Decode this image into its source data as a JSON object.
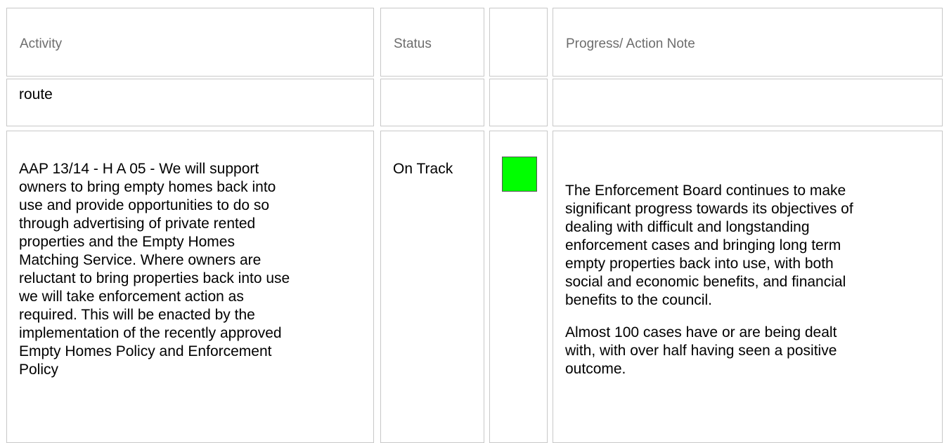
{
  "table": {
    "headers": {
      "activity": "Activity",
      "status": "Status",
      "indicator": "",
      "note": "Progress/ Action Note"
    },
    "rows": [
      {
        "activity": "route",
        "status": "",
        "note": ""
      },
      {
        "activity": "AAP 13/14 - H A 05 - We will support\nowners to bring empty homes back into\nuse and provide opportunities to do so\nthrough advertising of private rented\nproperties and the Empty Homes\nMatching Service. Where owners are\nreluctant to bring properties back into use\nwe will take enforcement action as\nrequired. This will be enacted by the\nimplementation of the recently approved\nEmpty Homes Policy and Enforcement\nPolicy",
        "status": "On Track",
        "status_color": "#00ff00",
        "note_paragraph_1": "The Enforcement Board continues to make\nsignificant progress towards its objectives of\ndealing with difficult and longstanding\nenforcement cases and bringing long term\nempty properties back into use, with both\nsocial and economic benefits, and financial\nbenefits to the council.",
        "note_paragraph_2": "Almost 100 cases have or are being dealt\nwith, with over half having seen a positive\noutcome."
      }
    ]
  }
}
